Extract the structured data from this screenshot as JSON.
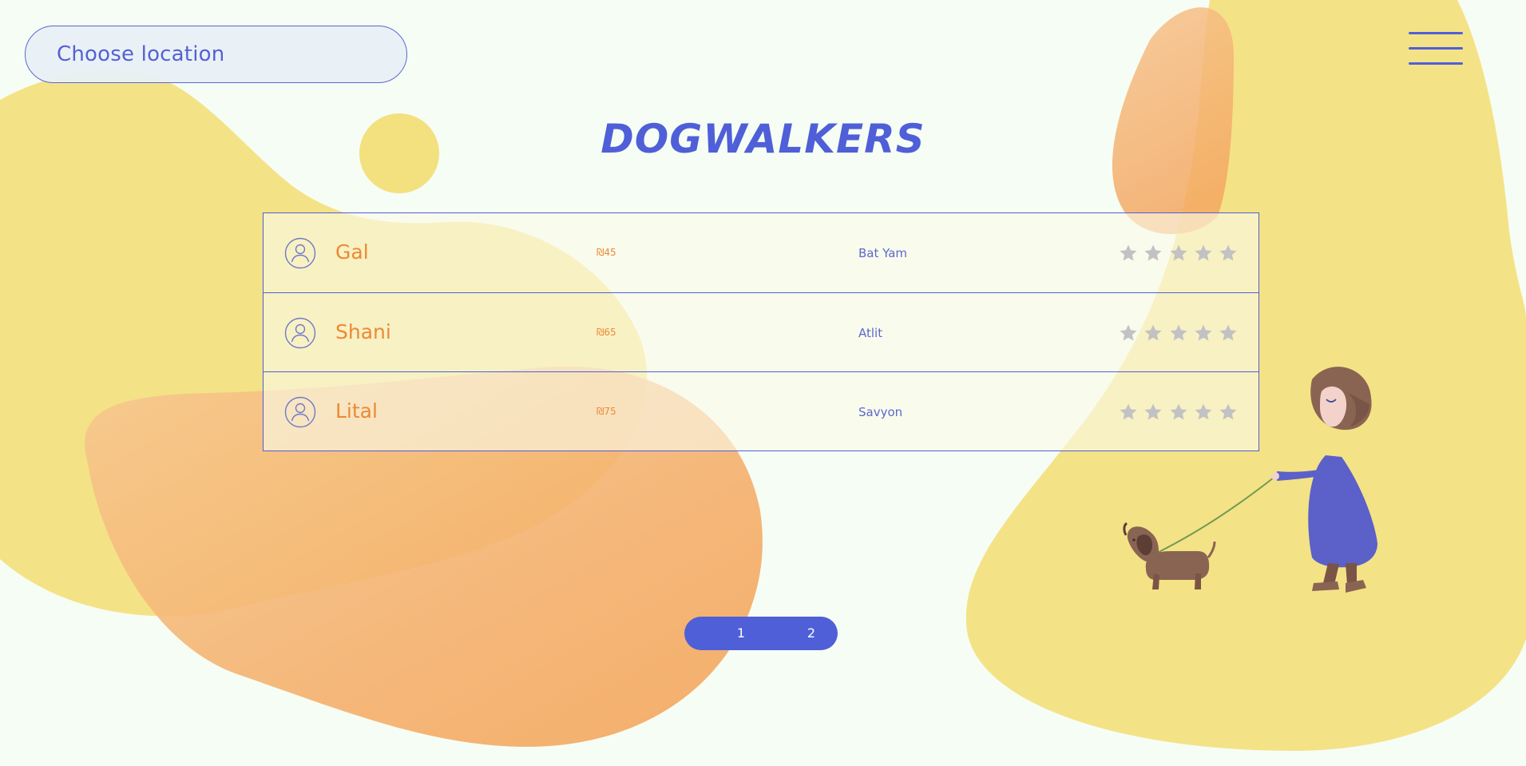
{
  "location_selector": {
    "label": "Choose location"
  },
  "menu": {
    "icon": "hamburger-menu-icon"
  },
  "page_title": "DOGWALKERS",
  "walkers": [
    {
      "name": "Gal",
      "price": "₪45",
      "location": "Bat Yam",
      "rating": 0,
      "max_rating": 5
    },
    {
      "name": "Shani",
      "price": "₪65",
      "location": "Atlit",
      "rating": 0,
      "max_rating": 5
    },
    {
      "name": "Lital",
      "price": "₪75",
      "location": "Savyon",
      "rating": 0,
      "max_rating": 5
    }
  ],
  "pagination": {
    "pages": [
      "1",
      "2"
    ]
  },
  "colors": {
    "accent": "#4f5fd8",
    "name_text": "#ec8a34",
    "star_inactive": "#c2c2c4",
    "background": "#f6fdf4",
    "blob_yellow": "#f3e07f",
    "blob_orange": "#f5a65d"
  },
  "icons": {
    "avatar": "user-avatar-icon",
    "star": "star-icon"
  }
}
